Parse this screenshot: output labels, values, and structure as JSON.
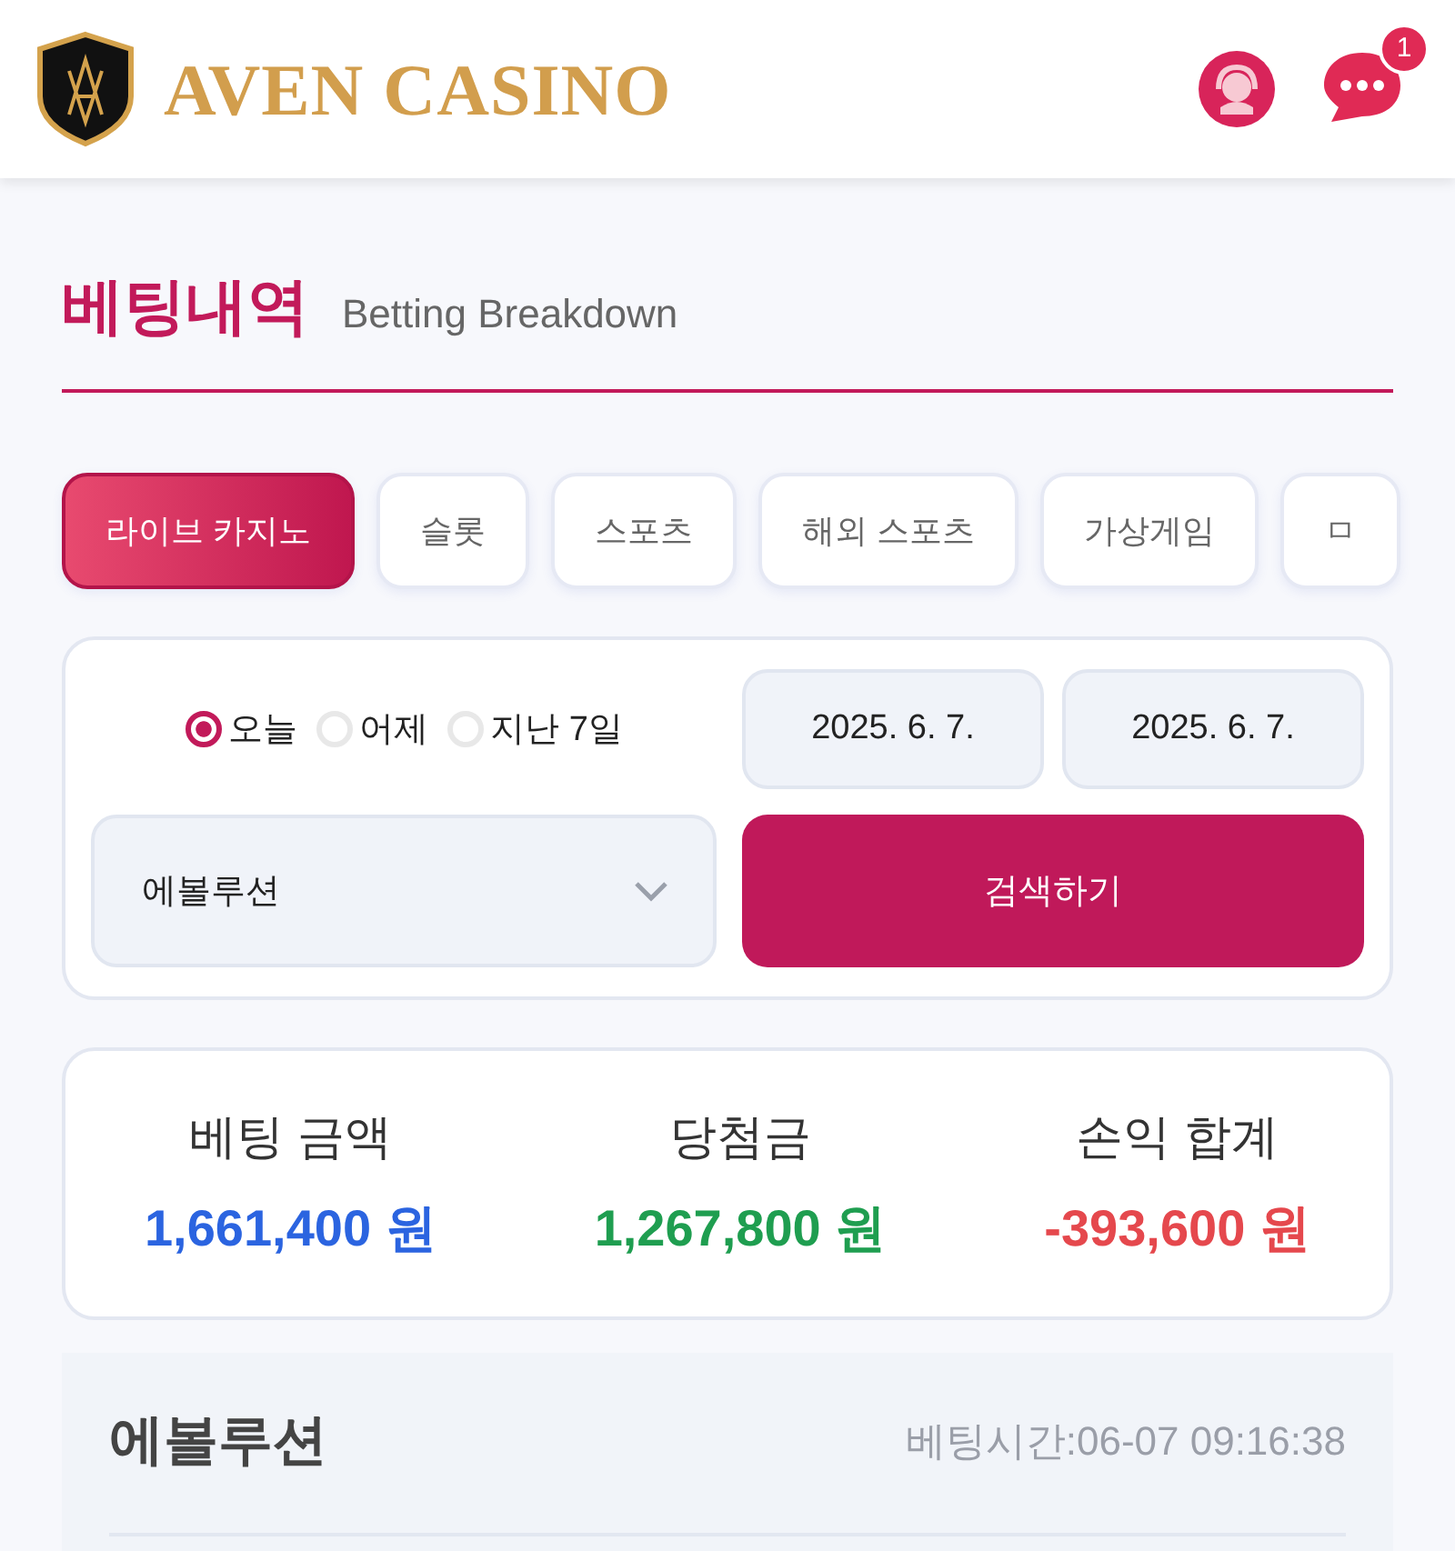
{
  "header": {
    "brand": "AVEN CASINO",
    "notification_count": "1"
  },
  "page": {
    "title": "베팅내역",
    "subtitle": "Betting Breakdown"
  },
  "tabs": [
    {
      "label": "라이브 카지노",
      "selected": true
    },
    {
      "label": "슬롯",
      "selected": false
    },
    {
      "label": "스포츠",
      "selected": false
    },
    {
      "label": "해외 스포츠",
      "selected": false
    },
    {
      "label": "가상게임",
      "selected": false
    },
    {
      "label": "ㅁ",
      "selected": false
    }
  ],
  "filter": {
    "periods": [
      {
        "label": "오늘",
        "selected": true
      },
      {
        "label": "어제",
        "selected": false
      },
      {
        "label": "지난 7일",
        "selected": false
      }
    ],
    "date_from": "2025. 6. 7.",
    "date_to": "2025. 6. 7.",
    "provider": "에볼루션",
    "search_button": "검색하기"
  },
  "summary": [
    {
      "label": "베팅 금액",
      "value": "1,661,400 원",
      "color": "#2b64e0"
    },
    {
      "label": "당첨금",
      "value": "1,267,800 원",
      "color": "#1f9e50"
    },
    {
      "label": "손익 합계",
      "value": "-393,600 원",
      "color": "#e5484d"
    }
  ],
  "record": {
    "provider": "에볼루션",
    "time": "베팅시간:06-07 09:16:38"
  }
}
